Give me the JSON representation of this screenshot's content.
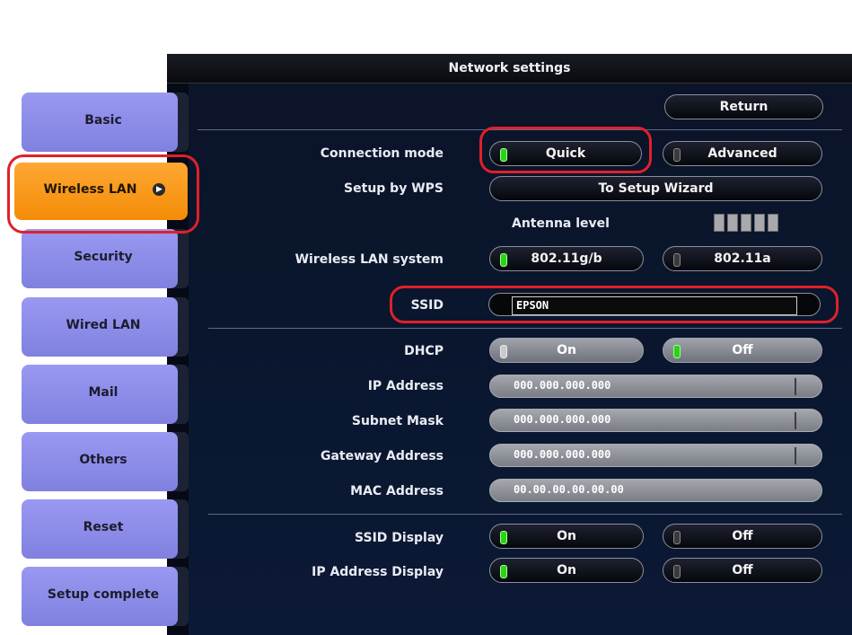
{
  "window": {
    "title": "Network settings"
  },
  "tabs": [
    {
      "label": "Basic"
    },
    {
      "label": "Wireless LAN",
      "active": true
    },
    {
      "label": "Security"
    },
    {
      "label": "Wired LAN"
    },
    {
      "label": "Mail"
    },
    {
      "label": "Others"
    },
    {
      "label": "Reset"
    },
    {
      "label": "Setup complete"
    }
  ],
  "return_label": "Return",
  "connection_mode": {
    "label": "Connection mode",
    "options": [
      "Quick",
      "Advanced"
    ],
    "selected": "Quick"
  },
  "wps": {
    "label": "Setup by WPS",
    "button": "To Setup Wizard"
  },
  "antenna": {
    "label": "Antenna level",
    "bars": 5
  },
  "wlan_system": {
    "label": "Wireless LAN system",
    "options": [
      "802.11g/b",
      "802.11a"
    ],
    "selected": "802.11g/b"
  },
  "ssid": {
    "label": "SSID",
    "value": "EPSON"
  },
  "dhcp": {
    "label": "DHCP",
    "options": [
      "On",
      "Off"
    ],
    "selected": "Off"
  },
  "ip_address": {
    "label": "IP Address",
    "value": "000.000.000.000"
  },
  "subnet_mask": {
    "label": "Subnet Mask",
    "value": "000.000.000.000"
  },
  "gateway": {
    "label": "Gateway Address",
    "value": "000.000.000.000"
  },
  "mac": {
    "label": "MAC Address",
    "value": "00.00.00.00.00.00"
  },
  "ssid_display": {
    "label": "SSID Display",
    "options": [
      "On",
      "Off"
    ],
    "selected": "On"
  },
  "ip_display": {
    "label": "IP Address Display",
    "options": [
      "On",
      "Off"
    ],
    "selected": "On"
  },
  "colors": {
    "active_tab": "#f38c07",
    "tab": "#8c8ce8",
    "callout": "#e0202a",
    "led_on": "#2bd21a"
  }
}
